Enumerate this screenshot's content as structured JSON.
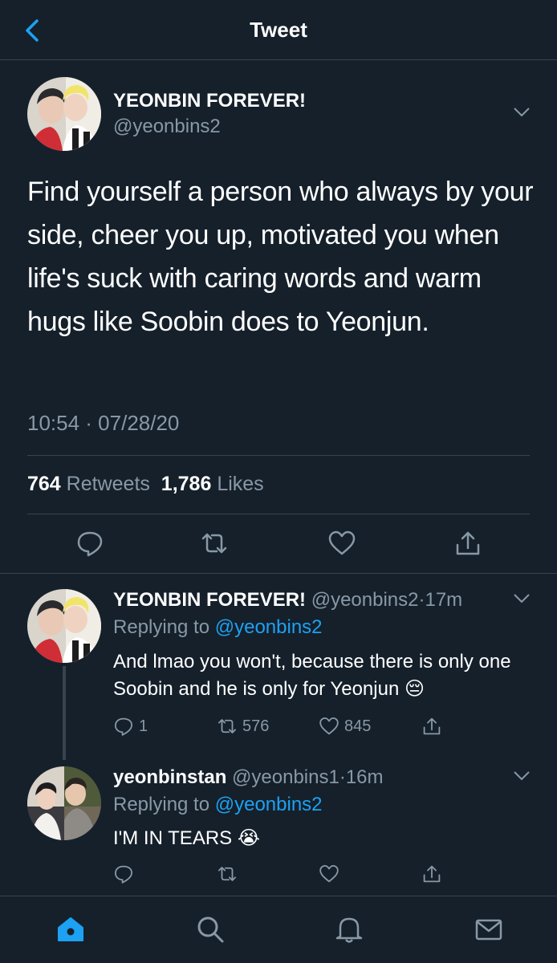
{
  "header": {
    "title": "Tweet",
    "back_icon": "chevron-left-icon"
  },
  "main_tweet": {
    "name": "YEONBIN FOREVER!",
    "handle": "@yeonbins2",
    "text": "Find yourself a person who always by your side, cheer you up, motivated you when life's suck with caring words and warm hugs like Soobin does to Yeonjun.",
    "timestamp": "10:54 · 07/28/20",
    "retweets_count": "764",
    "retweets_label": "Retweets",
    "likes_count": "1,786",
    "likes_label": "Likes"
  },
  "replies": [
    {
      "name": "YEONBIN FOREVER!",
      "handle": "@yeonbins2",
      "sep": "·",
      "time": "17m",
      "replying_label": "Replying to",
      "replying_to": "@yeonbins2",
      "text": "And lmao you won't, because there is only one Soobin and he is only for Yeonjun 😔",
      "reply_count": "1",
      "retweet_count": "576",
      "like_count": "845"
    },
    {
      "name": "yeonbinstan",
      "handle": "@yeonbins1",
      "sep": "·",
      "time": "16m",
      "replying_label": "Replying to",
      "replying_to": "@yeonbins2",
      "text": "I'M IN TEARS 😭",
      "reply_count": "",
      "retweet_count": "",
      "like_count": ""
    }
  ],
  "nav": [
    "home-icon",
    "search-icon",
    "notifications-icon",
    "messages-icon"
  ],
  "colors": {
    "background": "#15202b",
    "border": "#38444d",
    "muted": "#8899a6",
    "accent": "#1da1f2"
  }
}
